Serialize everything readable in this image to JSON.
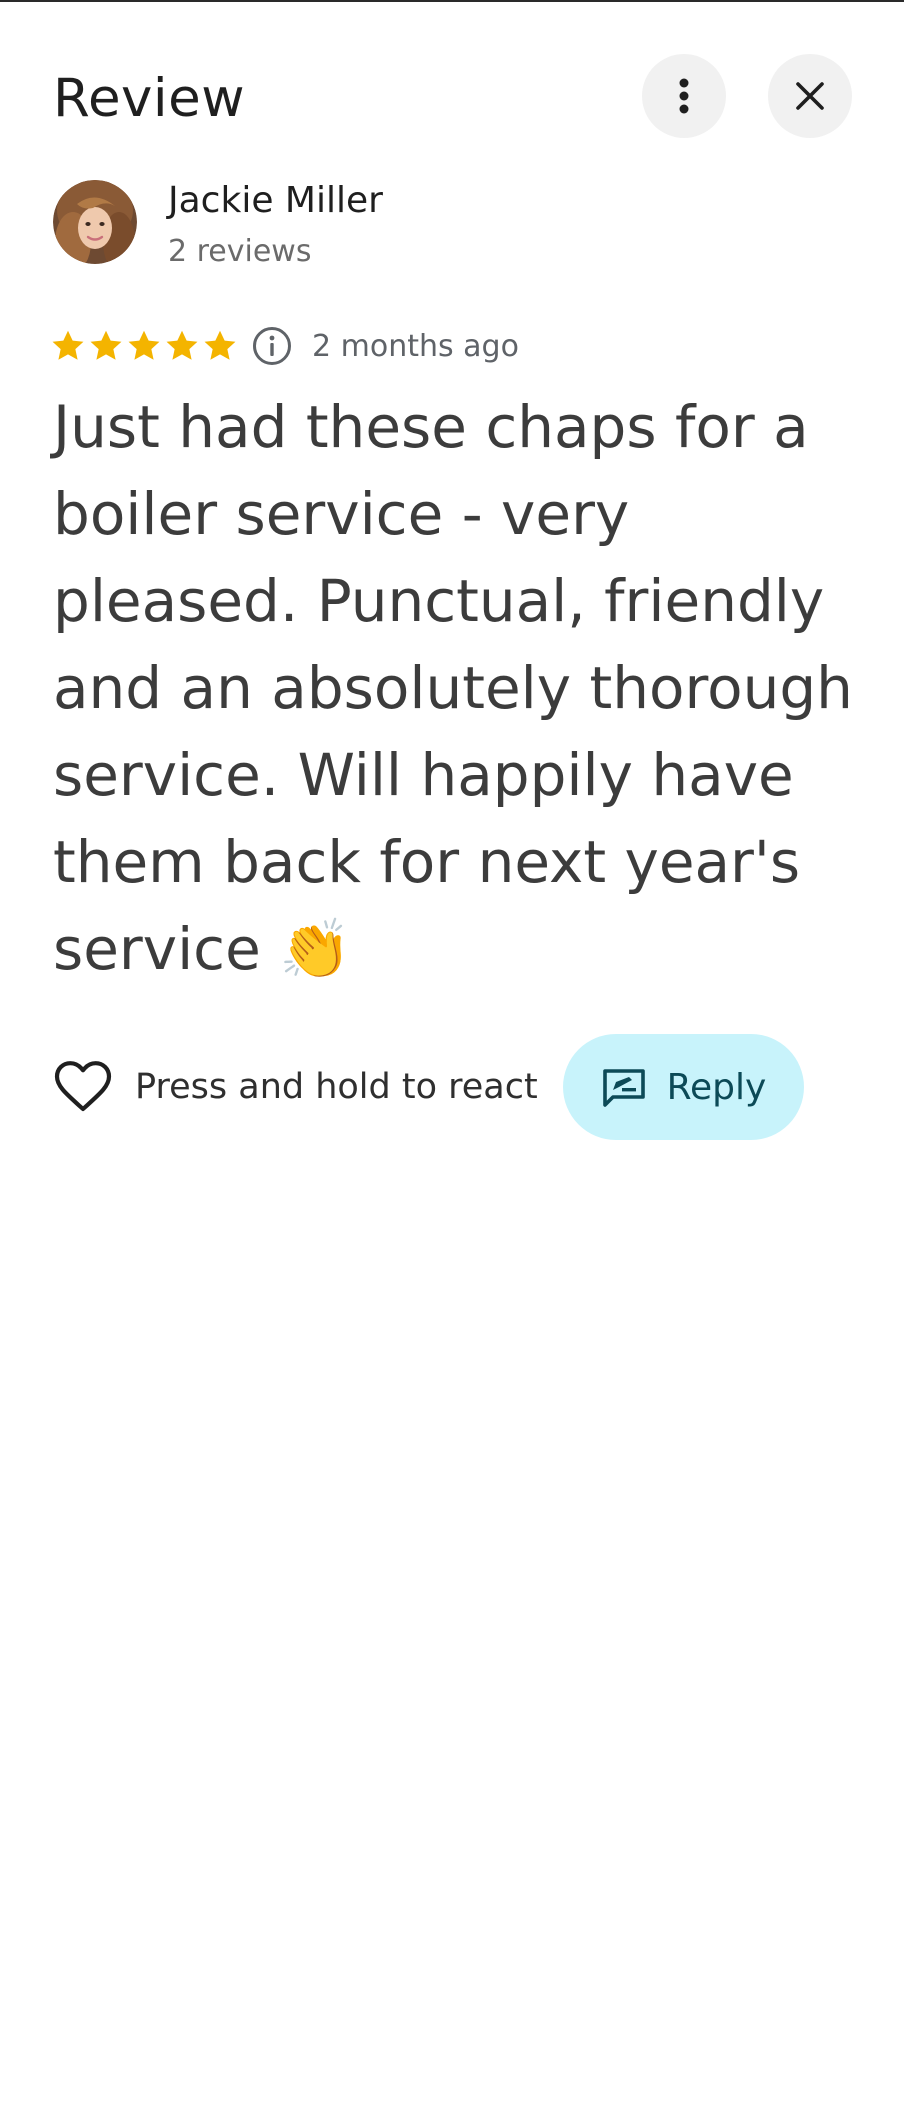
{
  "header": {
    "title": "Review",
    "more_icon": "more-vert-icon",
    "close_icon": "close-icon"
  },
  "author": {
    "name": "Jackie Miller",
    "review_count": "2 reviews"
  },
  "rating": {
    "stars": 5,
    "max_stars": 5,
    "star_color": "#f4b400",
    "info_icon": "info-icon",
    "time_ago": "2 months ago"
  },
  "review": {
    "text": "Just had these chaps for a boiler service - very pleased. Punctual, friendly and an absolutely thorough service. Will happily have them back for next year's service 👏"
  },
  "actions": {
    "react_label": "Press and hold to react",
    "react_icon": "heart-outline-icon",
    "reply_label": "Reply",
    "reply_icon": "rate-review-icon",
    "reply_bg": "#c8f3fb"
  }
}
